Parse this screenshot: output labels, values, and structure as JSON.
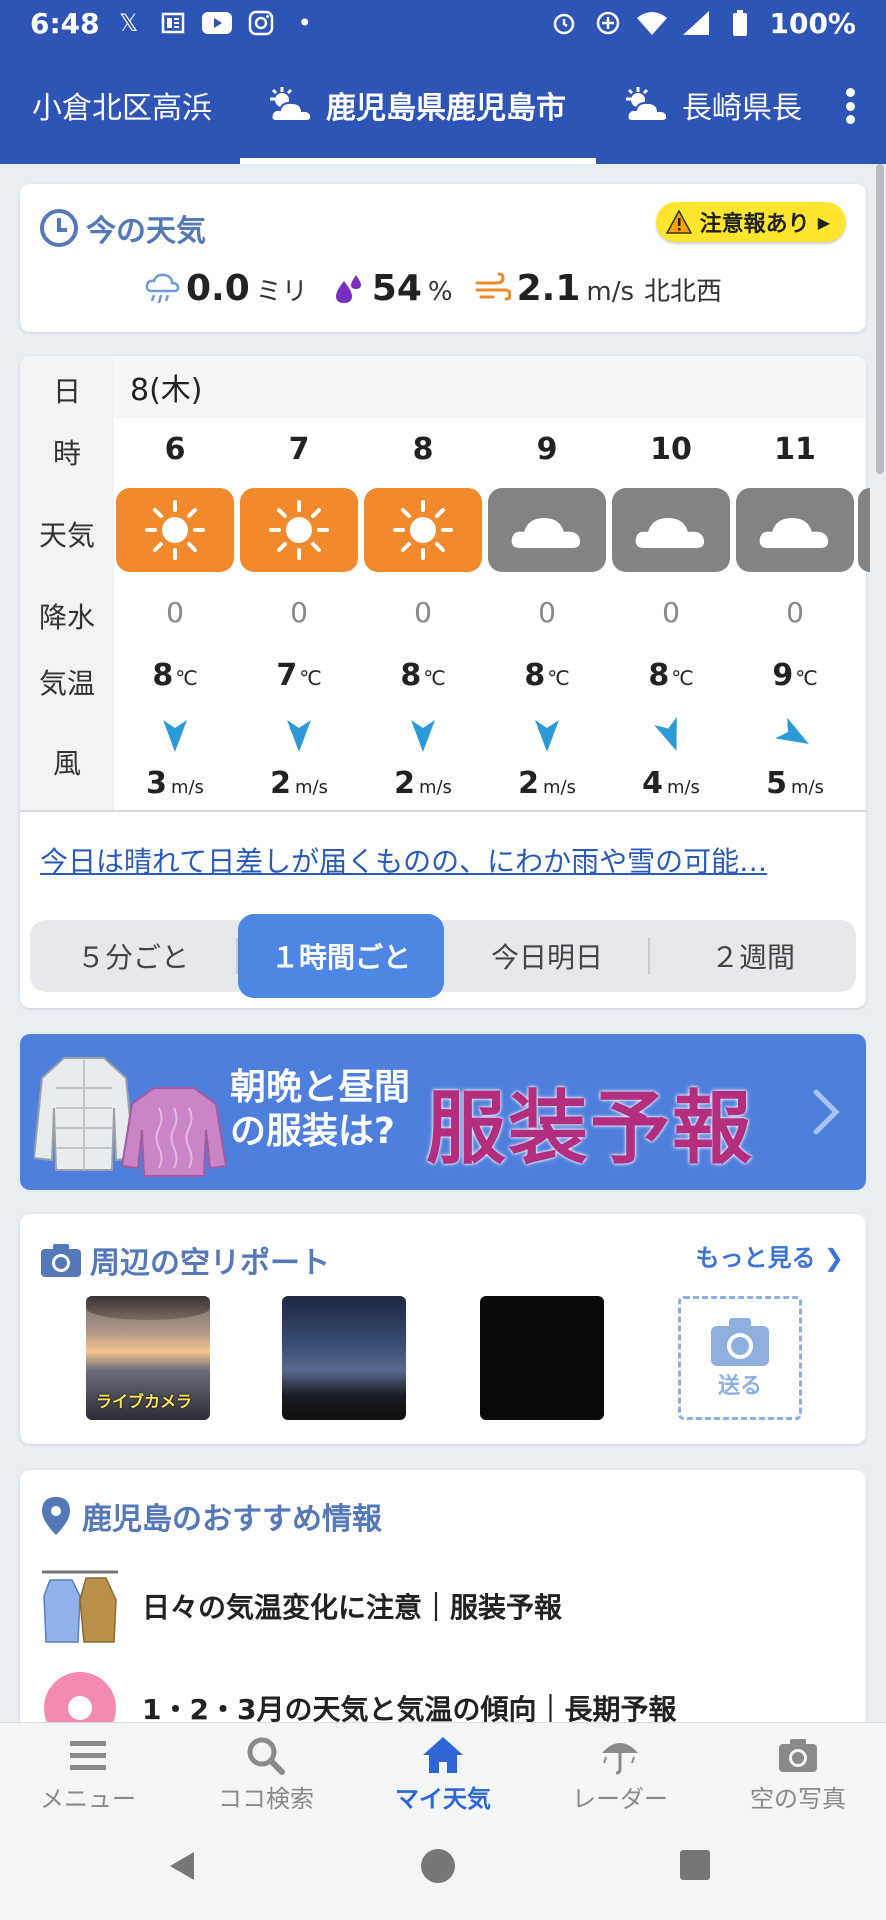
{
  "status_bar": {
    "time": "6:48",
    "battery": "100%",
    "left_icons": [
      "x-icon",
      "news-icon",
      "youtube-icon",
      "instagram-icon",
      "dot-icon"
    ],
    "right_icons": [
      "alarm-icon",
      "sync-icon",
      "wifi-icon",
      "signal-icon",
      "battery-icon"
    ]
  },
  "location_tabs": [
    {
      "label": "小倉北区高浜",
      "active": false
    },
    {
      "label": "鹿児島県鹿児島市",
      "active": true,
      "icon": "cloud-sun-icon"
    },
    {
      "label": "長崎県長",
      "active": false,
      "icon": "cloud-sun-icon"
    }
  ],
  "current_weather": {
    "title": "今の天気",
    "alert": "注意報あり",
    "precip_value": "0.0",
    "precip_unit": "ミリ",
    "humidity_value": "54",
    "humidity_unit": "%",
    "wind_value": "2.1",
    "wind_unit": "m/s",
    "wind_dir": "北北西"
  },
  "hourly": {
    "row_labels": {
      "day": "日",
      "hour": "時",
      "weather": "天気",
      "rain": "降水",
      "temp": "気温",
      "wind": "風"
    },
    "date": "8(木)",
    "temp_unit": "℃",
    "wind_unit": "m/s",
    "hours": [
      {
        "hour": "6",
        "weather": "sunny",
        "rain": "0",
        "temp": "8",
        "wind": "3",
        "wind_dir_deg": 0
      },
      {
        "hour": "7",
        "weather": "sunny",
        "rain": "0",
        "temp": "7",
        "wind": "2",
        "wind_dir_deg": 0
      },
      {
        "hour": "8",
        "weather": "sunny",
        "rain": "0",
        "temp": "8",
        "wind": "2",
        "wind_dir_deg": 0
      },
      {
        "hour": "9",
        "weather": "cloudy",
        "rain": "0",
        "temp": "8",
        "wind": "2",
        "wind_dir_deg": 0
      },
      {
        "hour": "10",
        "weather": "cloudy",
        "rain": "0",
        "temp": "8",
        "wind": "4",
        "wind_dir_deg": -20
      },
      {
        "hour": "11",
        "weather": "cloudy",
        "rain": "0",
        "temp": "9",
        "wind": "5",
        "wind_dir_deg": -60
      }
    ],
    "summary_link": "今日は晴れて日差しが届くものの、にわか雨や雪の可能…",
    "segments": [
      "５分ごと",
      "１時間ごと",
      "今日明日",
      "２週間"
    ],
    "active_segment": "１時間ごと"
  },
  "banner": {
    "line1": "朝晩と昼間",
    "line2": "の服装は?",
    "headline": "服装予報"
  },
  "sky_report": {
    "title": "周辺の空リポート",
    "more": "もっと見る",
    "live_label": "ライブカメラ",
    "send_label": "送る"
  },
  "recommend": {
    "title": "鹿児島のおすすめ情報",
    "items": [
      "日々の気温変化に注意｜服装予報",
      "1・2・3月の天気と気温の傾向｜長期予報"
    ]
  },
  "bottom_nav": [
    {
      "label": "メニュー",
      "icon": "menu-icon"
    },
    {
      "label": "ココ検索",
      "icon": "search-icon"
    },
    {
      "label": "マイ天気",
      "icon": "home-icon"
    },
    {
      "label": "レーダー",
      "icon": "radar-umbrella-icon"
    },
    {
      "label": "空の写真",
      "icon": "camera-icon"
    }
  ],
  "colors": {
    "brand_blue": "#2e54b6",
    "accent_blue": "#4e86e3",
    "sunny_orange": "#f08a2c",
    "cloudy_gray": "#838383",
    "alert_yellow": "#ffe62e"
  }
}
